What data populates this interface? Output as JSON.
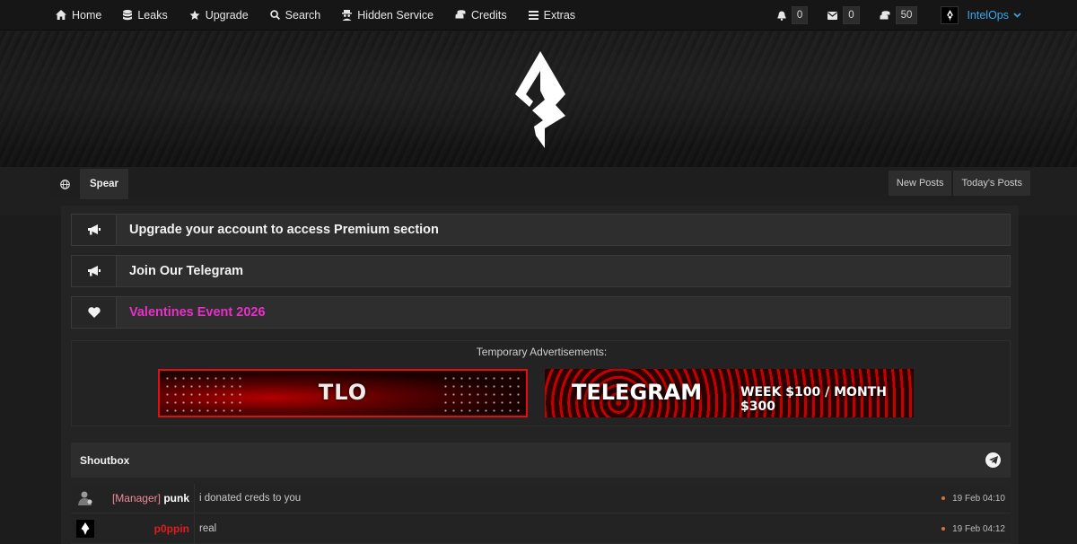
{
  "nav": {
    "items": [
      {
        "label": "Home",
        "icon": "home-icon"
      },
      {
        "label": "Leaks",
        "icon": "database-icon"
      },
      {
        "label": "Upgrade",
        "icon": "star-icon"
      },
      {
        "label": "Search",
        "icon": "search-icon"
      },
      {
        "label": "Hidden Service",
        "icon": "spy-icon"
      },
      {
        "label": "Credits",
        "icon": "coins-icon"
      },
      {
        "label": "Extras",
        "icon": "menu-icon"
      }
    ],
    "notifications": "0",
    "messages": "0",
    "credits": "50",
    "username": "IntelOps"
  },
  "breadcrumb": {
    "current": "Spear",
    "new_posts": "New Posts",
    "todays_posts": "Today's Posts"
  },
  "announcements": [
    {
      "text": "Upgrade your account to access Premium section",
      "icon": "bullhorn-icon",
      "color": "#f2f2f2"
    },
    {
      "text": "Join Our Telegram",
      "icon": "bullhorn-icon",
      "color": "#f2f2f2"
    },
    {
      "text": "Valentines Event 2026",
      "icon": "heart-icon",
      "color": "#e830c8"
    }
  ],
  "ads": {
    "title": "Temporary Advertisements:",
    "ad1_text": "TLO",
    "ad2_text": "TELEGRAM",
    "ad2_sub": "WEEK $100 / MONTH $300"
  },
  "shoutbox": {
    "title": "Shoutbox",
    "rows": [
      {
        "role": "[Manager]",
        "name": "punk",
        "message": "i donated creds to you",
        "time": "19 Feb 04:10"
      },
      {
        "role": "",
        "name": "p0ppin",
        "message": "real",
        "time": "19 Feb 04:12"
      }
    ]
  },
  "colors": {
    "accent_user": "#3da6ea",
    "valentines": "#e830c8",
    "manager_role": "#f08a9a",
    "p0ppin_name": "#e11d1d"
  }
}
